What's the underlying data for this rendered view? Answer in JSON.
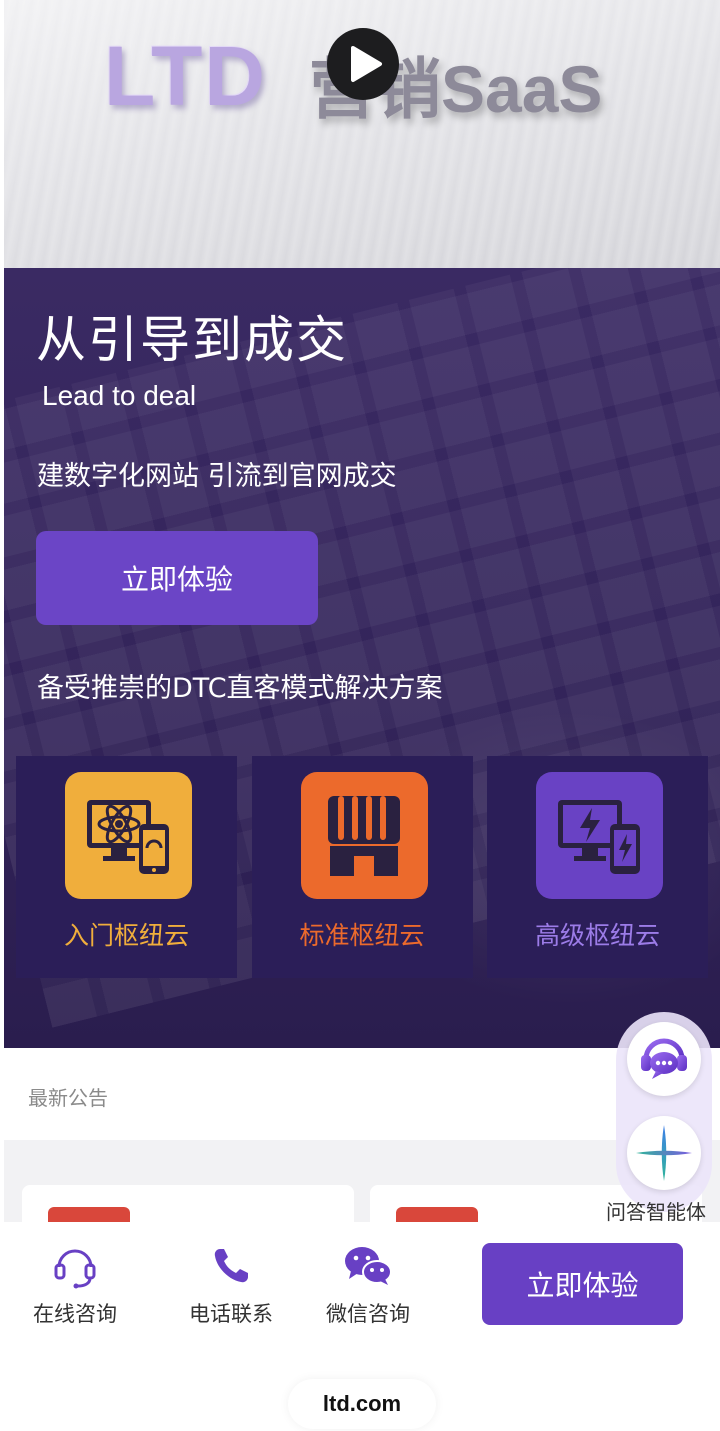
{
  "video": {
    "logo_ltd": "LTD",
    "logo_rest": "营销SaaS",
    "play_icon": "play-icon"
  },
  "hero": {
    "title": "从引导到成交",
    "subtitle": "Lead to deal",
    "description": "建数字化网站 引流到官网成交",
    "cta_label": "立即体验",
    "tagline": "备受推崇的DTC直客模式解决方案",
    "plans": [
      {
        "label": "入门枢纽云",
        "icon": "atom-monitor-icon",
        "color": "#f0ae3c",
        "label_color": "#f0ae3c"
      },
      {
        "label": "标准枢纽云",
        "icon": "storefront-icon",
        "color": "#ec6a2c",
        "label_color": "#ec6a2c"
      },
      {
        "label": "高级枢纽云",
        "icon": "power-monitor-icon",
        "color": "#6942c4",
        "label_color": "#9c7ce8"
      }
    ]
  },
  "notice": {
    "title": "最新公告"
  },
  "floating": {
    "chat_icon": "customer-service-icon",
    "ai_icon": "ai-plus-icon",
    "ai_label": "问答智能体"
  },
  "actionbar": {
    "online_label": "在线咨询",
    "phone_label": "电话联系",
    "wechat_label": "微信咨询",
    "cta_label": "立即体验"
  },
  "browser": {
    "url": "ltd.com"
  },
  "colors": {
    "brand_purple": "#6840c4",
    "hero_bg": "#35265c"
  }
}
